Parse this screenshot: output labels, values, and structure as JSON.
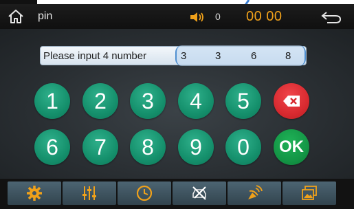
{
  "header": {
    "title": "pin",
    "volume": "0",
    "clock": "00 00"
  },
  "pin_entry": {
    "prompt": "Please input 4 number",
    "digits": [
      "3",
      "3",
      "6",
      "8"
    ]
  },
  "keypad": {
    "row1": [
      "1",
      "2",
      "3",
      "4",
      "5"
    ],
    "row2": [
      "6",
      "7",
      "8",
      "9",
      "0"
    ],
    "delete_icon": "backspace-icon",
    "ok_label": "OK"
  },
  "bottom_tabs": [
    {
      "icon": "gear-icon"
    },
    {
      "icon": "equalizer-icon"
    },
    {
      "icon": "clock-icon"
    },
    {
      "icon": "car-tools-icon"
    },
    {
      "icon": "satellite-icon"
    },
    {
      "icon": "gallery-icon"
    }
  ],
  "colors": {
    "accent_clock": "#f0a11a",
    "key_green": "#15906c",
    "delete_red": "#d82a30",
    "ok_green": "#149646",
    "callout_arrow": "#3b7fd4"
  }
}
